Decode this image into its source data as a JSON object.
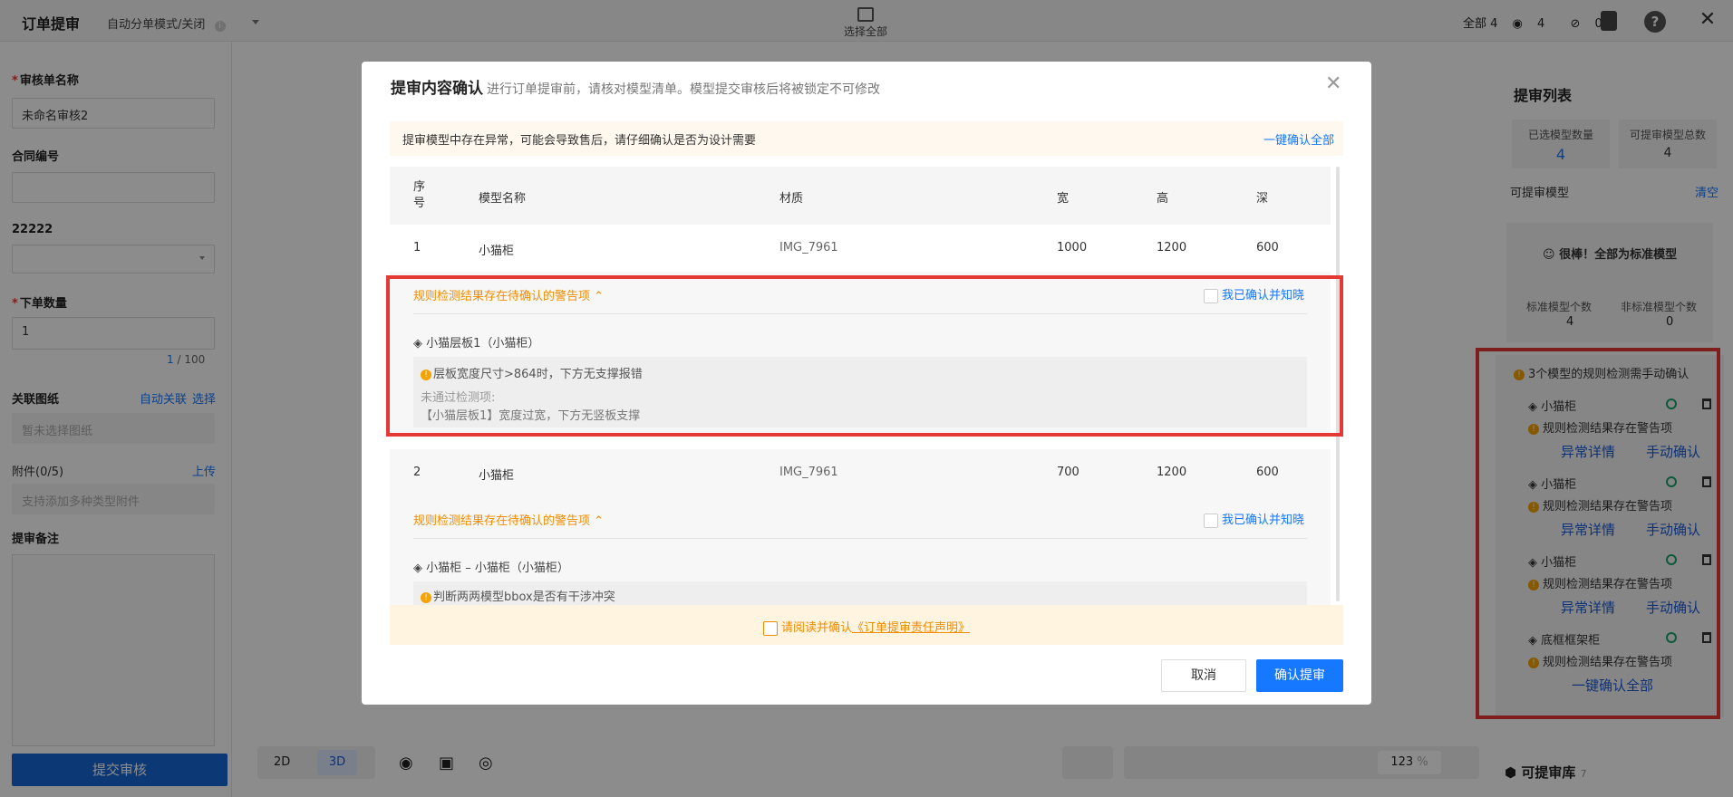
{
  "app": {
    "title": "订单提审",
    "mode": "自动分单模式/关闭",
    "select_all": "选择全部"
  },
  "stats": {
    "all": "全部 4",
    "visible": "4",
    "hidden": "0"
  },
  "left": {
    "name_label": "审核单名称",
    "name_value": "未命名审核2",
    "contract_label": "合同编号",
    "field_label": "22222",
    "qty_label": "下单数量",
    "qty_value": "1",
    "qty_count": "1",
    "qty_max": "/ 100",
    "drawing_label": "关联图纸",
    "auto_link": "自动关联",
    "select_link": "选择",
    "drawing_placeholder": "暂未选择图纸",
    "attach_label": "附件(0/5)",
    "upload": "上传",
    "attach_placeholder": "支持添加多种类型附件",
    "note_label": "提审备注",
    "submit": "提交审核"
  },
  "right": {
    "title": "提审列表",
    "selected_label": "已选模型数量",
    "selected_value": "4",
    "total_label": "可提审模型总数",
    "total_value": "4",
    "reviewable_label": "可提审模型",
    "clear": "清空",
    "all_standard": "很棒！全部为标准模型",
    "std_label": "标准模型个数",
    "std_value": "4",
    "nonstd_label": "非标准模型个数",
    "nonstd_value": "0",
    "warn_title": "3个模型的规则检测需手动确认",
    "items": [
      {
        "name": "小猫柜",
        "warn": "规则检测结果存在警告项",
        "detail": "异常详情",
        "confirm": "手动确认"
      },
      {
        "name": "小猫柜",
        "warn": "规则检测结果存在警告项",
        "detail": "异常详情",
        "confirm": "手动确认"
      },
      {
        "name": "小猫柜",
        "warn": "规则检测结果存在警告项",
        "detail": "异常详情",
        "confirm": "手动确认"
      },
      {
        "name": "底框框架柜",
        "warn": "规则检测结果存在警告项"
      }
    ],
    "confirm_all": "一键确认全部",
    "library": "可提审库",
    "library_count": "7"
  },
  "bottom": {
    "view2d": "2D",
    "view3d": "3D",
    "zoom": "123",
    "pct": "%"
  },
  "modal": {
    "title": "提审内容确认",
    "subtitle": "进行订单提审前，请核对模型清单。模型提交审核后将被锁定不可修改",
    "notice": "提审模型中存在异常，可能会导致售后，请仔细确认是否为设计需要",
    "confirm_all": "一键确认全部",
    "columns": {
      "seq": "序号",
      "name": "模型名称",
      "material": "材质",
      "width": "宽",
      "height": "高",
      "depth": "深"
    },
    "rows": [
      {
        "seq": "1",
        "name": "小猫柜",
        "material": "IMG_7961",
        "width": "1000",
        "height": "1200",
        "depth": "600",
        "warn_title": "规则检测结果存在待确认的警告项",
        "ack": "我已确认并知晓",
        "part": "小猫层板1（小猫柜）",
        "rule": "层板宽度尺寸>864时，下方无支撑报错",
        "fail_label": "未通过检测项:",
        "fail": "【小猫层板1】宽度过宽，下方无竖板支撑"
      },
      {
        "seq": "2",
        "name": "小猫柜",
        "material": "IMG_7961",
        "width": "700",
        "height": "1200",
        "depth": "600",
        "warn_title": "规则检测结果存在待确认的警告项",
        "ack": "我已确认并知晓",
        "part": "小猫柜 – 小猫柜（小猫柜）",
        "rule": "判断两两模型bbox是否有干涉冲突"
      }
    ],
    "declare_prefix": "请阅读并确认",
    "declare_link": "《订单提审责任声明》",
    "cancel": "取消",
    "ok": "确认提审"
  }
}
